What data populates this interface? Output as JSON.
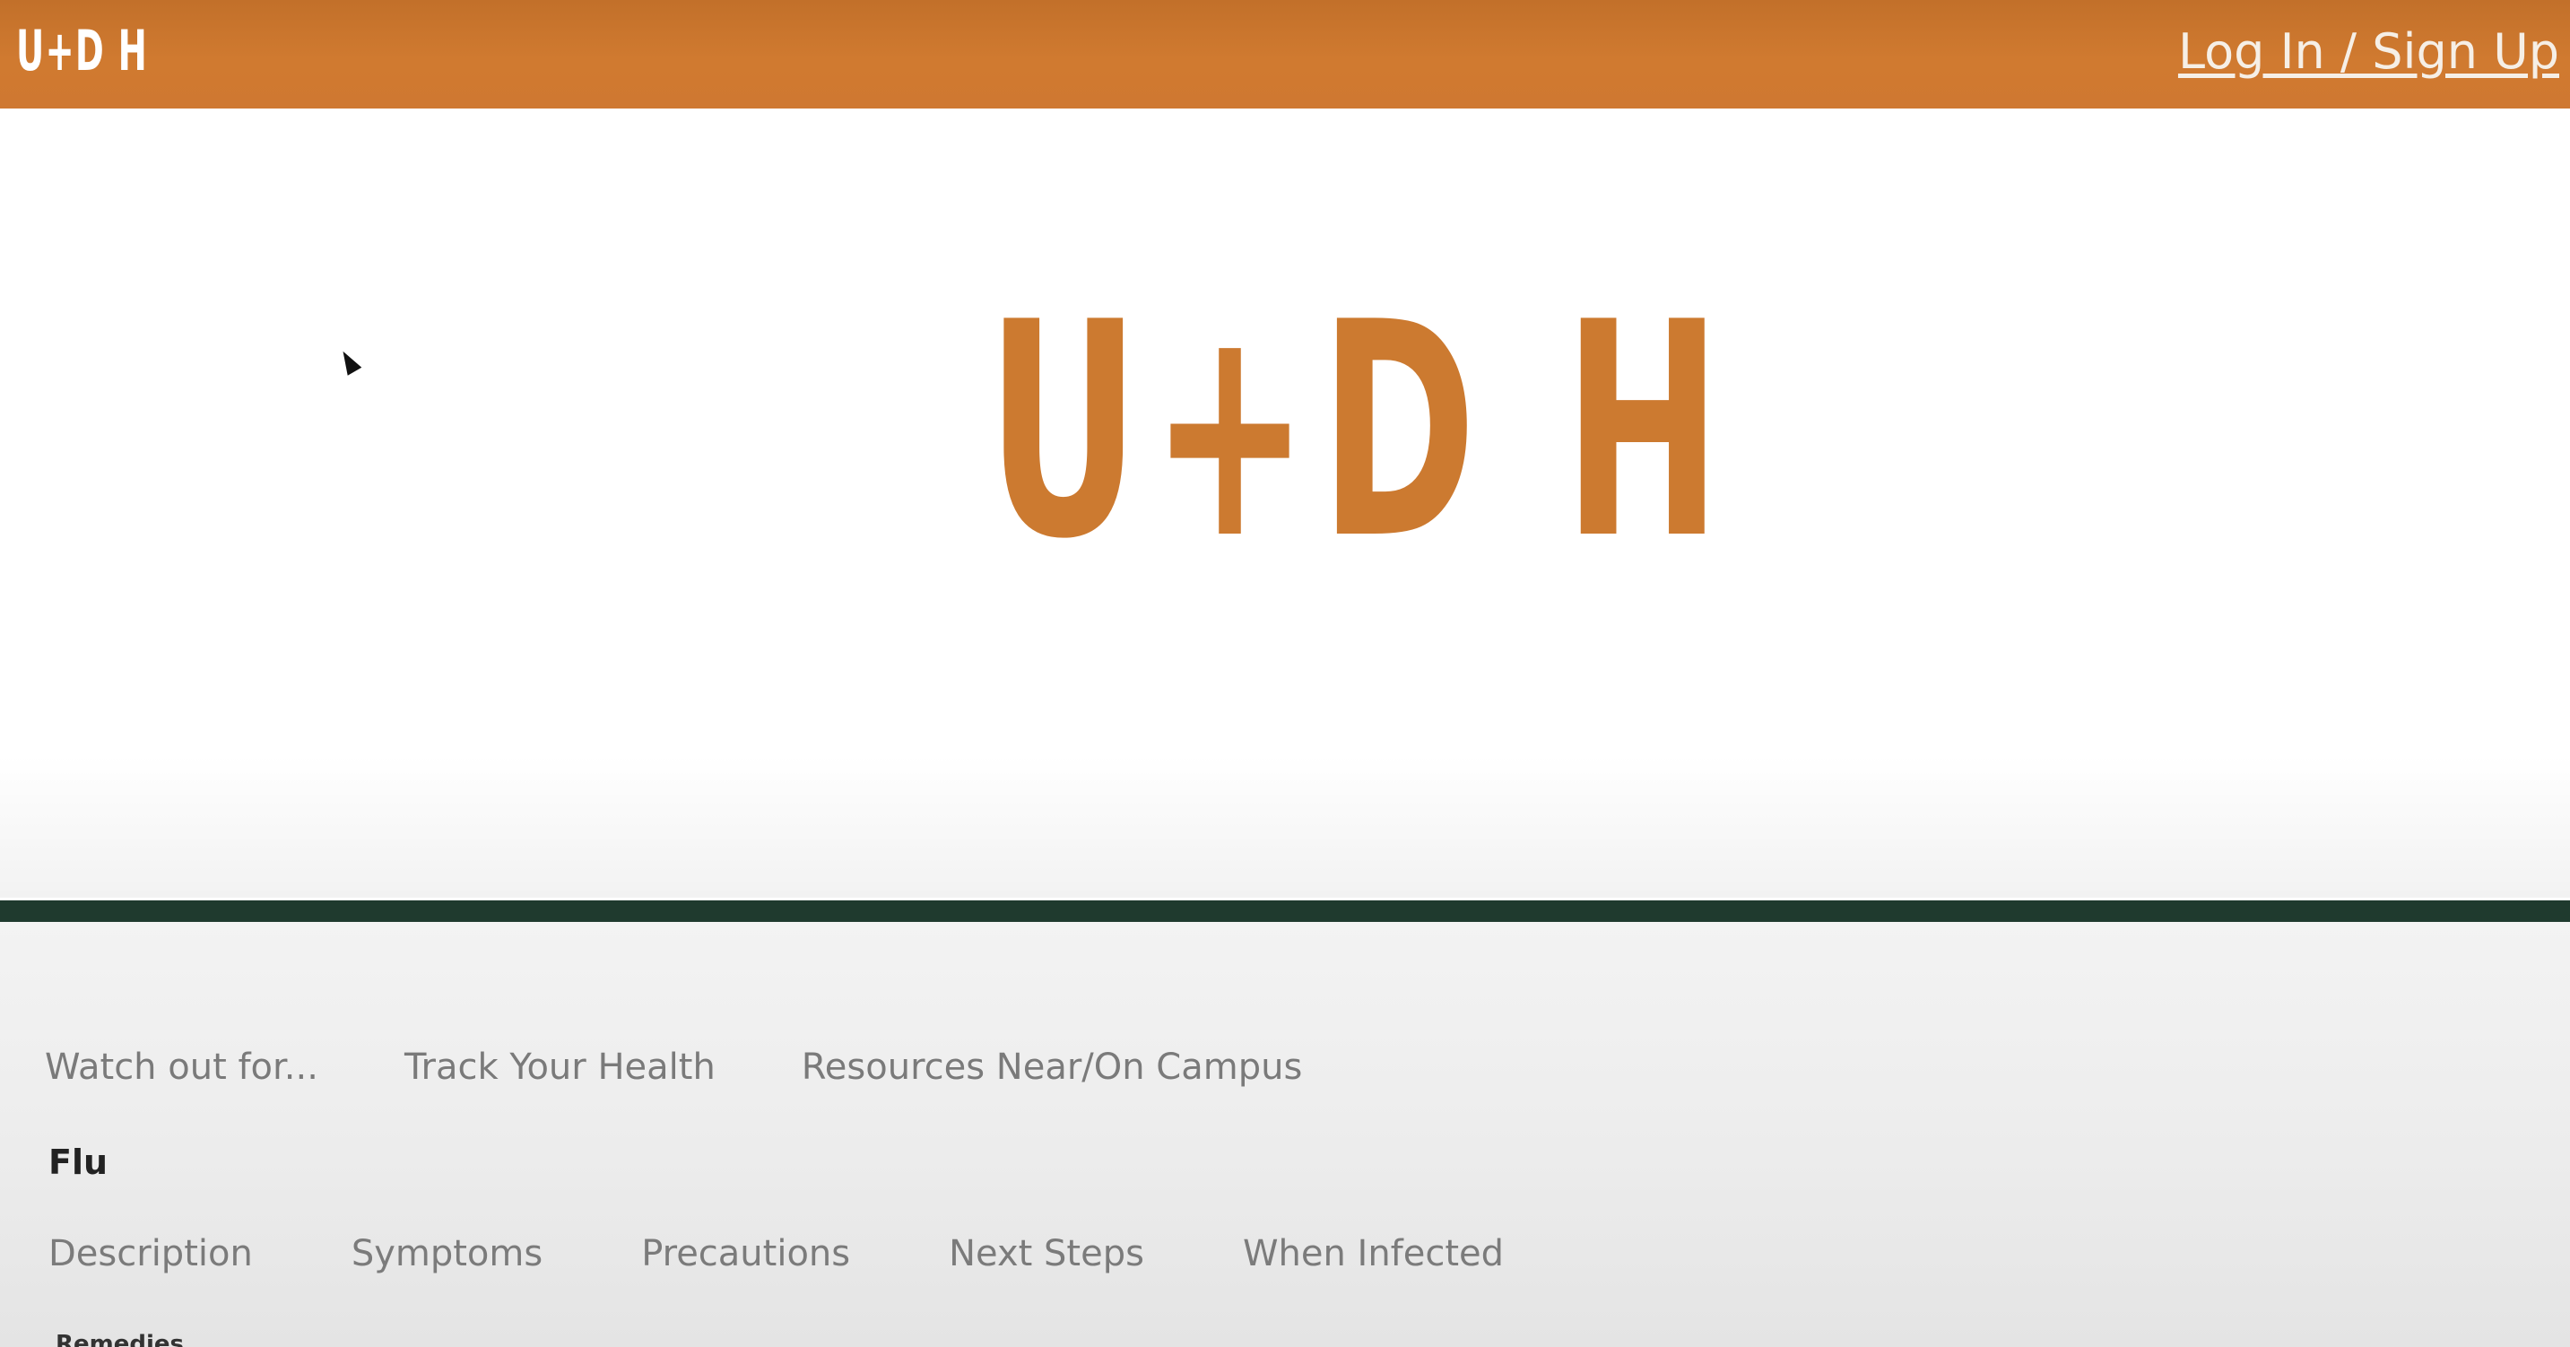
{
  "header": {
    "logo_text": "U+D H",
    "auth_link": "Log In / Sign Up"
  },
  "hero": {
    "logo_text": "U+D H"
  },
  "nav": {
    "items": [
      {
        "label": "Watch out for..."
      },
      {
        "label": "Track Your Health"
      },
      {
        "label": "Resources Near/On Campus"
      }
    ]
  },
  "section": {
    "title": "Flu",
    "tabs": [
      {
        "label": "Description"
      },
      {
        "label": "Symptoms"
      },
      {
        "label": "Precautions"
      },
      {
        "label": "Next Steps"
      },
      {
        "label": "When Infected"
      }
    ],
    "cut_off_label": "Remedies"
  },
  "colors": {
    "brand_orange": "#cc7a30",
    "divider_green": "#1f3a2e"
  }
}
